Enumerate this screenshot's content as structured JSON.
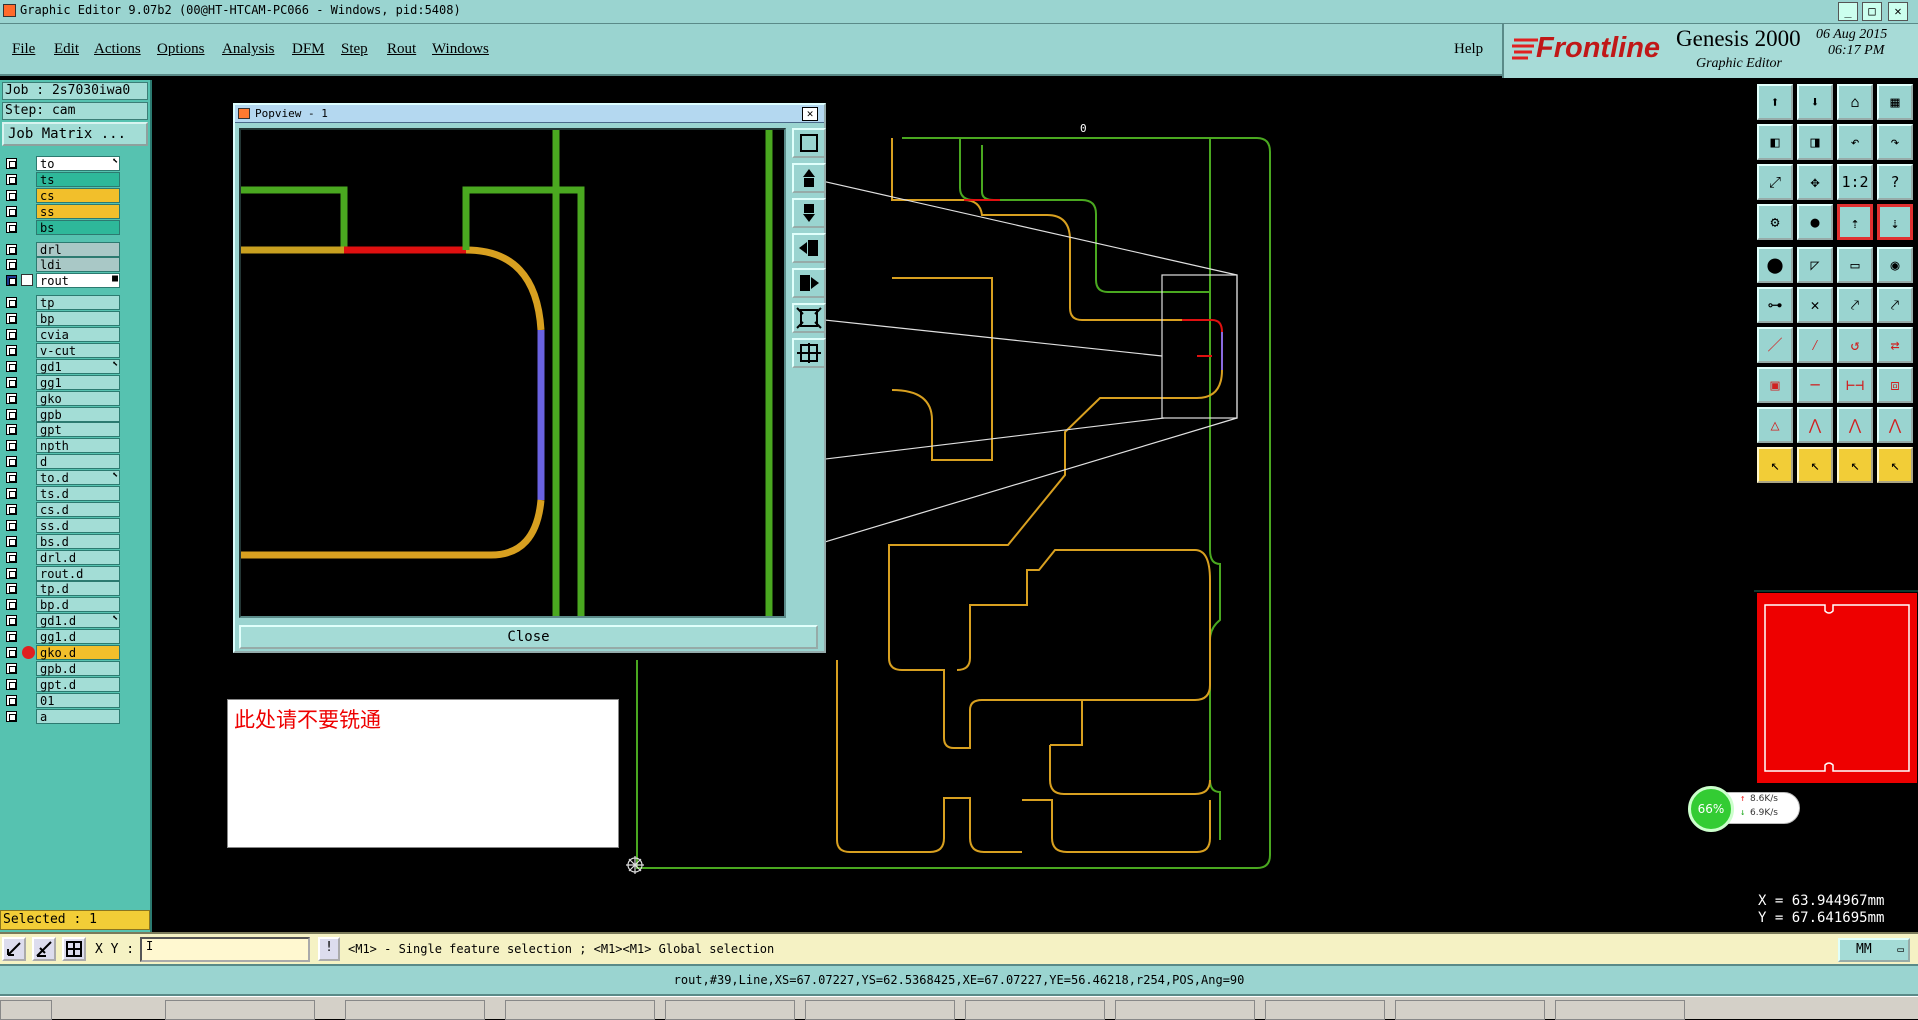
{
  "window": {
    "title": "Graphic Editor 9.07b2 (00@HT-HTCAM-PC066 - Windows, pid:5408)",
    "min_label": "_",
    "max_label": "□",
    "close_label": "✕"
  },
  "menu": {
    "items": [
      "File",
      "Edit",
      "Actions",
      "Options",
      "Analysis",
      "DFM",
      "Step",
      "Rout",
      "Windows"
    ],
    "help": "Help"
  },
  "brand": {
    "company": "Frontline",
    "product": "Genesis 2000",
    "subtitle": "Graphic Editor",
    "date": "06 Aug 2015",
    "time": "06:17 PM"
  },
  "job": {
    "label": "Job : 2s7030iwa0",
    "step": "Step: cam"
  },
  "job_matrix_label": "Job Matrix ...",
  "layers": [
    {
      "name": "to",
      "color": "#ffffff",
      "mark": "⬉"
    },
    {
      "name": "ts",
      "color": "#2eb89a",
      "mark": ""
    },
    {
      "name": "cs",
      "color": "#f2bf2b",
      "mark": ""
    },
    {
      "name": "ss",
      "color": "#f2bf2b",
      "mark": ""
    },
    {
      "name": "bs",
      "color": "#2eb89a",
      "mark": ""
    },
    {
      "name": "drl",
      "color": "#a9c8c6",
      "mark": ""
    },
    {
      "name": "ldi",
      "color": "#a9c8c6",
      "mark": ""
    },
    {
      "name": "rout",
      "color": "#ffffff",
      "mark": "■"
    },
    {
      "name": "tp",
      "color": "#a3ddd6",
      "mark": ""
    },
    {
      "name": "bp",
      "color": "#a3ddd6",
      "mark": ""
    },
    {
      "name": "cvia",
      "color": "#a3ddd6",
      "mark": ""
    },
    {
      "name": "v-cut",
      "color": "#a3ddd6",
      "mark": ""
    },
    {
      "name": "gd1",
      "color": "#a3ddd6",
      "mark": "⬉"
    },
    {
      "name": "gg1",
      "color": "#a3ddd6",
      "mark": ""
    },
    {
      "name": "gko",
      "color": "#a3ddd6",
      "mark": ""
    },
    {
      "name": "gpb",
      "color": "#a3ddd6",
      "mark": ""
    },
    {
      "name": "gpt",
      "color": "#a3ddd6",
      "mark": ""
    },
    {
      "name": "npth",
      "color": "#a3ddd6",
      "mark": ""
    },
    {
      "name": "d",
      "color": "#a3ddd6",
      "mark": ""
    },
    {
      "name": "to.d",
      "color": "#a3ddd6",
      "mark": "⬉"
    },
    {
      "name": "ts.d",
      "color": "#a3ddd6",
      "mark": ""
    },
    {
      "name": "cs.d",
      "color": "#a3ddd6",
      "mark": ""
    },
    {
      "name": "ss.d",
      "color": "#a3ddd6",
      "mark": ""
    },
    {
      "name": "bs.d",
      "color": "#a3ddd6",
      "mark": ""
    },
    {
      "name": "drl.d",
      "color": "#a3ddd6",
      "mark": ""
    },
    {
      "name": "rout.d",
      "color": "#a3ddd6",
      "mark": ""
    },
    {
      "name": "tp.d",
      "color": "#a3ddd6",
      "mark": ""
    },
    {
      "name": "bp.d",
      "color": "#a3ddd6",
      "mark": ""
    },
    {
      "name": "gd1.d",
      "color": "#a3ddd6",
      "mark": "⬉"
    },
    {
      "name": "gg1.d",
      "color": "#a3ddd6",
      "mark": ""
    },
    {
      "name": "gko.d",
      "color": "#f2bf2b",
      "mark": ""
    },
    {
      "name": "gpb.d",
      "color": "#a3ddd6",
      "mark": ""
    },
    {
      "name": "gpt.d",
      "color": "#a3ddd6",
      "mark": ""
    },
    {
      "name": "01",
      "color": "#a3ddd6",
      "mark": ""
    },
    {
      "name": "a",
      "color": "#a3ddd6",
      "mark": ""
    }
  ],
  "selected": "Selected : 1",
  "popup": {
    "title": "Popview - 1",
    "close_label": "Close",
    "close_x": "✕"
  },
  "note": "此处请不要铣通",
  "canvas_label": "0",
  "speed": {
    "percent": "66%",
    "up": "8.6K/s",
    "down": "6.9K/s"
  },
  "coords": {
    "x": "X = 63.944967mm",
    "y": "Y = 67.641695mm"
  },
  "cmd": {
    "xy_label": "X Y :",
    "xy_value": "I",
    "info_label": "!",
    "message": "<M1> - Single feature selection ; <M1><M1> Global selection",
    "units": "MM"
  },
  "status": "rout,#39,Line,XS=67.07227,YS=62.5368425,XE=67.07227,YE=56.46218,r254,POS,Ang=90",
  "toolbar_icons": [
    "zoom-fit-icon",
    "zoom-home-icon",
    "home-icon",
    "grid-icon",
    "pan-left-icon",
    "pan-right-icon",
    "undo-icon",
    "redo-icon",
    "expand-icon",
    "center-icon",
    "scale-icon",
    "help-icon",
    "settings-icon",
    "probe-icon",
    "layer-up-icon",
    "layer-down-icon",
    "snap-icon",
    "measure-icon",
    "ruler-icon",
    "target-icon",
    "net-icon",
    "cross-icon",
    "node-icon",
    "link-icon",
    "line-icon",
    "arc-icon",
    "rotate-icon",
    "mirror-icon",
    "select-box-icon",
    "dash-icon",
    "gauge-icon",
    "pad-icon",
    "triangle-icon",
    "angle-icon",
    "outline-icon",
    "outline2-icon",
    "pointer-icon",
    "pointer-red-icon",
    "pointer-yellow-icon",
    "pointer-net-icon"
  ]
}
